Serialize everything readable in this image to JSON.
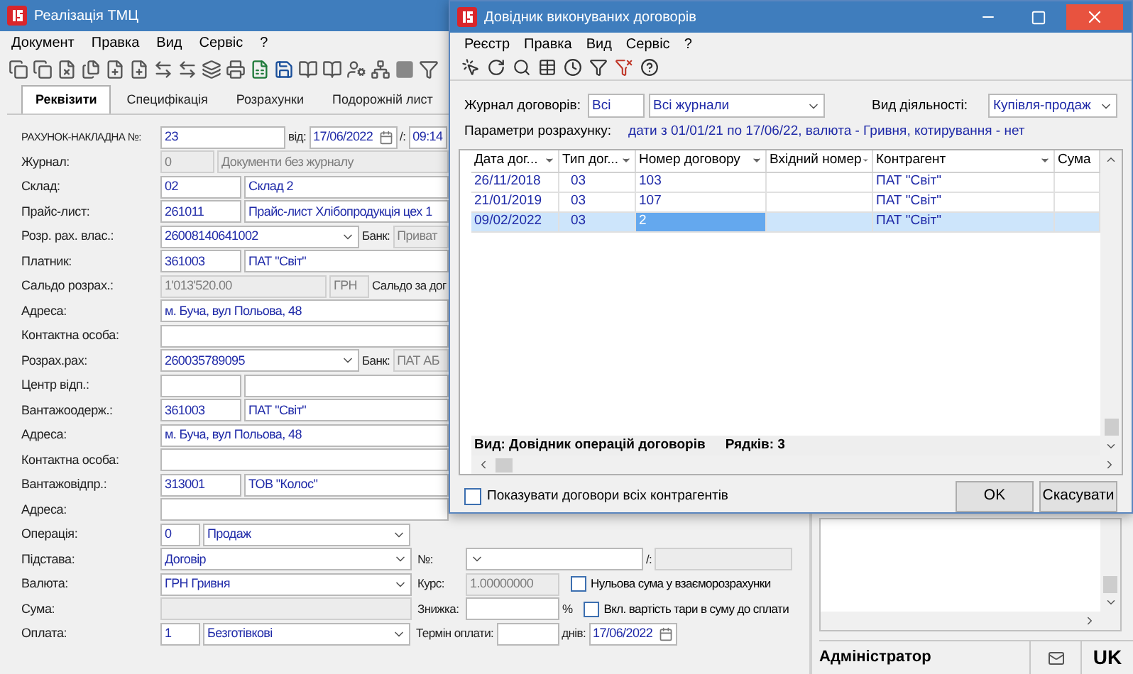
{
  "main_window": {
    "title": "Реалізація ТМЦ",
    "menu": [
      "Документ",
      "Правка",
      "Вид",
      "Сервіс",
      "?"
    ],
    "tabs": [
      {
        "label": "Реквізити",
        "selected": true
      },
      {
        "label": "Специфікація",
        "selected": false
      },
      {
        "label": "Розрахунки",
        "selected": false
      },
      {
        "label": "Подорожній лист",
        "selected": false
      }
    ],
    "rows": [
      {
        "label": "РАХУНОК-НАКЛАДНА №:",
        "fields": [
          {
            "kind": "doc_number",
            "value": "23",
            "disabled": false
          },
          {
            "kind": "caption",
            "value": "від:"
          },
          {
            "kind": "date",
            "value": "17/06/2022",
            "disabled": false
          },
          {
            "kind": "caption",
            "value": "/:"
          },
          {
            "kind": "time",
            "value": "09:14",
            "disabled": false
          }
        ]
      },
      {
        "label": "Журнал:",
        "fields": [
          {
            "kind": "num_code",
            "value": "0",
            "disabled": true
          },
          {
            "kind": "name",
            "value": "Документи без журналу",
            "disabled": true
          }
        ]
      },
      {
        "label": "Склад:",
        "fields": [
          {
            "kind": "code",
            "value": "02",
            "disabled": false
          },
          {
            "kind": "name",
            "value": "Склад 2",
            "disabled": false
          }
        ]
      },
      {
        "label": "Прайс-лист:",
        "fields": [
          {
            "kind": "code",
            "value": "261011",
            "disabled": false
          },
          {
            "kind": "name",
            "value": "Прайс-лист Хлібопродукція цех 1",
            "disabled": false
          }
        ]
      },
      {
        "label": "Розр. рах. влас.:",
        "fields": [
          {
            "kind": "account",
            "value": "26008140641002",
            "disabled": false
          },
          {
            "kind": "caption",
            "value": "Банк:"
          },
          {
            "kind": "name",
            "value": "Приват",
            "disabled": true
          }
        ]
      },
      {
        "label": "Платник:",
        "fields": [
          {
            "kind": "code",
            "value": "361003",
            "disabled": false
          },
          {
            "kind": "name",
            "value": "ПАТ \"Світ\"",
            "disabled": false
          }
        ]
      },
      {
        "label": "Сальдо розрах.:",
        "fields": [
          {
            "kind": "amount",
            "value": "1'013'520.00",
            "disabled": true
          },
          {
            "kind": "currency",
            "value": "ГРН",
            "disabled": true
          },
          {
            "kind": "caption",
            "value": "Сальдо за дог"
          }
        ]
      },
      {
        "label": "Адреса:",
        "fields": [
          {
            "kind": "name",
            "value": "м. Буча, вул Польова, 48",
            "disabled": false
          }
        ]
      },
      {
        "label": "Контактна особа:",
        "fields": [
          {
            "kind": "blank",
            "disabled": false
          }
        ]
      },
      {
        "label": "Розрах.рах:",
        "fields": [
          {
            "kind": "account",
            "value": "260035789095",
            "disabled": false
          },
          {
            "kind": "caption",
            "value": "Банк:"
          },
          {
            "kind": "name",
            "value": "ПАТ АБ",
            "disabled": true
          }
        ]
      },
      {
        "label": "Центр відп.:",
        "fields": [
          {
            "kind": "code_blank",
            "disabled": false
          },
          {
            "kind": "blank",
            "disabled": false
          }
        ]
      },
      {
        "label": "Вантажоодерж.:",
        "fields": [
          {
            "kind": "code",
            "value": "361003",
            "disabled": false
          },
          {
            "kind": "name",
            "value": "ПАТ \"Світ\"",
            "disabled": false
          }
        ]
      },
      {
        "label": "Адреса:",
        "fields": [
          {
            "kind": "name",
            "value": "м. Буча, вул Польова, 48",
            "disabled": false
          }
        ]
      },
      {
        "label": "Контактна особа:",
        "fields": [
          {
            "kind": "blank",
            "disabled": false
          }
        ]
      },
      {
        "label": "Вантажовідпр.:",
        "fields": [
          {
            "kind": "code",
            "value": "313001",
            "disabled": false
          },
          {
            "kind": "name",
            "value": "ТОВ \"Колос\"",
            "disabled": false
          }
        ]
      },
      {
        "label": "Адреса:",
        "fields": [
          {
            "kind": "blank",
            "disabled": false
          }
        ]
      },
      {
        "label": "Операція:",
        "fields": [
          {
            "kind": "num",
            "value": "0",
            "disabled": false
          },
          {
            "kind": "choice",
            "value": "Продаж",
            "disabled": false
          }
        ]
      },
      {
        "label": "Підстава:",
        "fields": [
          {
            "kind": "choice_wide",
            "value": "Договір",
            "disabled": false
          },
          {
            "kind": "side_caption",
            "value": "№:"
          },
          {
            "kind": "lookup",
            "disabled": false
          },
          {
            "kind": "caption",
            "value": "/:"
          },
          {
            "kind": "small",
            "disabled": true
          }
        ]
      },
      {
        "label": "Валюта:",
        "fields": [
          {
            "kind": "choice_wide",
            "value": "ГРН Гривня",
            "disabled": false
          },
          {
            "kind": "side_caption",
            "value": "Курс:"
          },
          {
            "kind": "rate",
            "value": "1.00000000",
            "disabled": true
          },
          {
            "kind": "checkbox",
            "value": "Нульова сума у взаєморозрахунки",
            "checked": false
          }
        ]
      },
      {
        "label": "Сума:",
        "fields": [
          {
            "kind": "blank_wide",
            "disabled": true
          },
          {
            "kind": "side_caption",
            "value": "Знижка:"
          },
          {
            "kind": "rate_blank",
            "disabled": false
          },
          {
            "kind": "caption",
            "value": "%"
          },
          {
            "kind": "checkbox",
            "value": "Вкл. вартість тари в суму до сплати",
            "checked": false
          }
        ]
      },
      {
        "label": "Оплата:",
        "fields": [
          {
            "kind": "num",
            "value": "1",
            "disabled": false
          },
          {
            "kind": "choice",
            "value": "Безготівкові",
            "disabled": false
          },
          {
            "kind": "side_caption",
            "value": "Термін оплати:"
          },
          {
            "kind": "term",
            "disabled": false
          },
          {
            "kind": "caption",
            "value": "днів:"
          },
          {
            "kind": "date",
            "value": "17/06/2022",
            "disabled": false
          }
        ]
      }
    ],
    "status_bar": {
      "user": "Адміністратор",
      "language": "UK"
    }
  },
  "dialog": {
    "title": "Довідник виконуваних договорів",
    "menu": [
      "Реєстр",
      "Правка",
      "Вид",
      "Сервіс",
      "?"
    ],
    "journal_label": "Журнал договорів:",
    "journal_code": "Всі",
    "journal_name": "Всі журнали",
    "activity_label": "Вид діяльності:",
    "activity": "Купівля-продаж",
    "params_label": "Параметри розрахунку:",
    "params": "дати з 01/01/21 по 17/06/22, валюта - Гривня, котирування - нет",
    "table": {
      "columns": [
        "Дата дог...",
        "Тип дог...",
        "Номер договору",
        "Вхідний номер",
        "Контрагент",
        "Сума"
      ],
      "rows": [
        {
          "date": "26/11/2018",
          "type": "03",
          "number": "103",
          "counterparty": "ПАТ \"Світ\"",
          "selected": false
        },
        {
          "date": "21/01/2019",
          "type": "03",
          "number": "107",
          "counterparty": "ПАТ \"Світ\"",
          "selected": false
        },
        {
          "date": "09/02/2022",
          "type": "03",
          "number": "2",
          "counterparty": "ПАТ \"Світ\"",
          "selected": true
        }
      ],
      "view": "Вид: Довідник операцій договорів",
      "count": "Рядків: 3"
    },
    "show_all": {
      "label": "Показувати договори всіх контрагентів",
      "checked": false
    },
    "buttons": [
      "OK",
      "Скасувати"
    ]
  }
}
